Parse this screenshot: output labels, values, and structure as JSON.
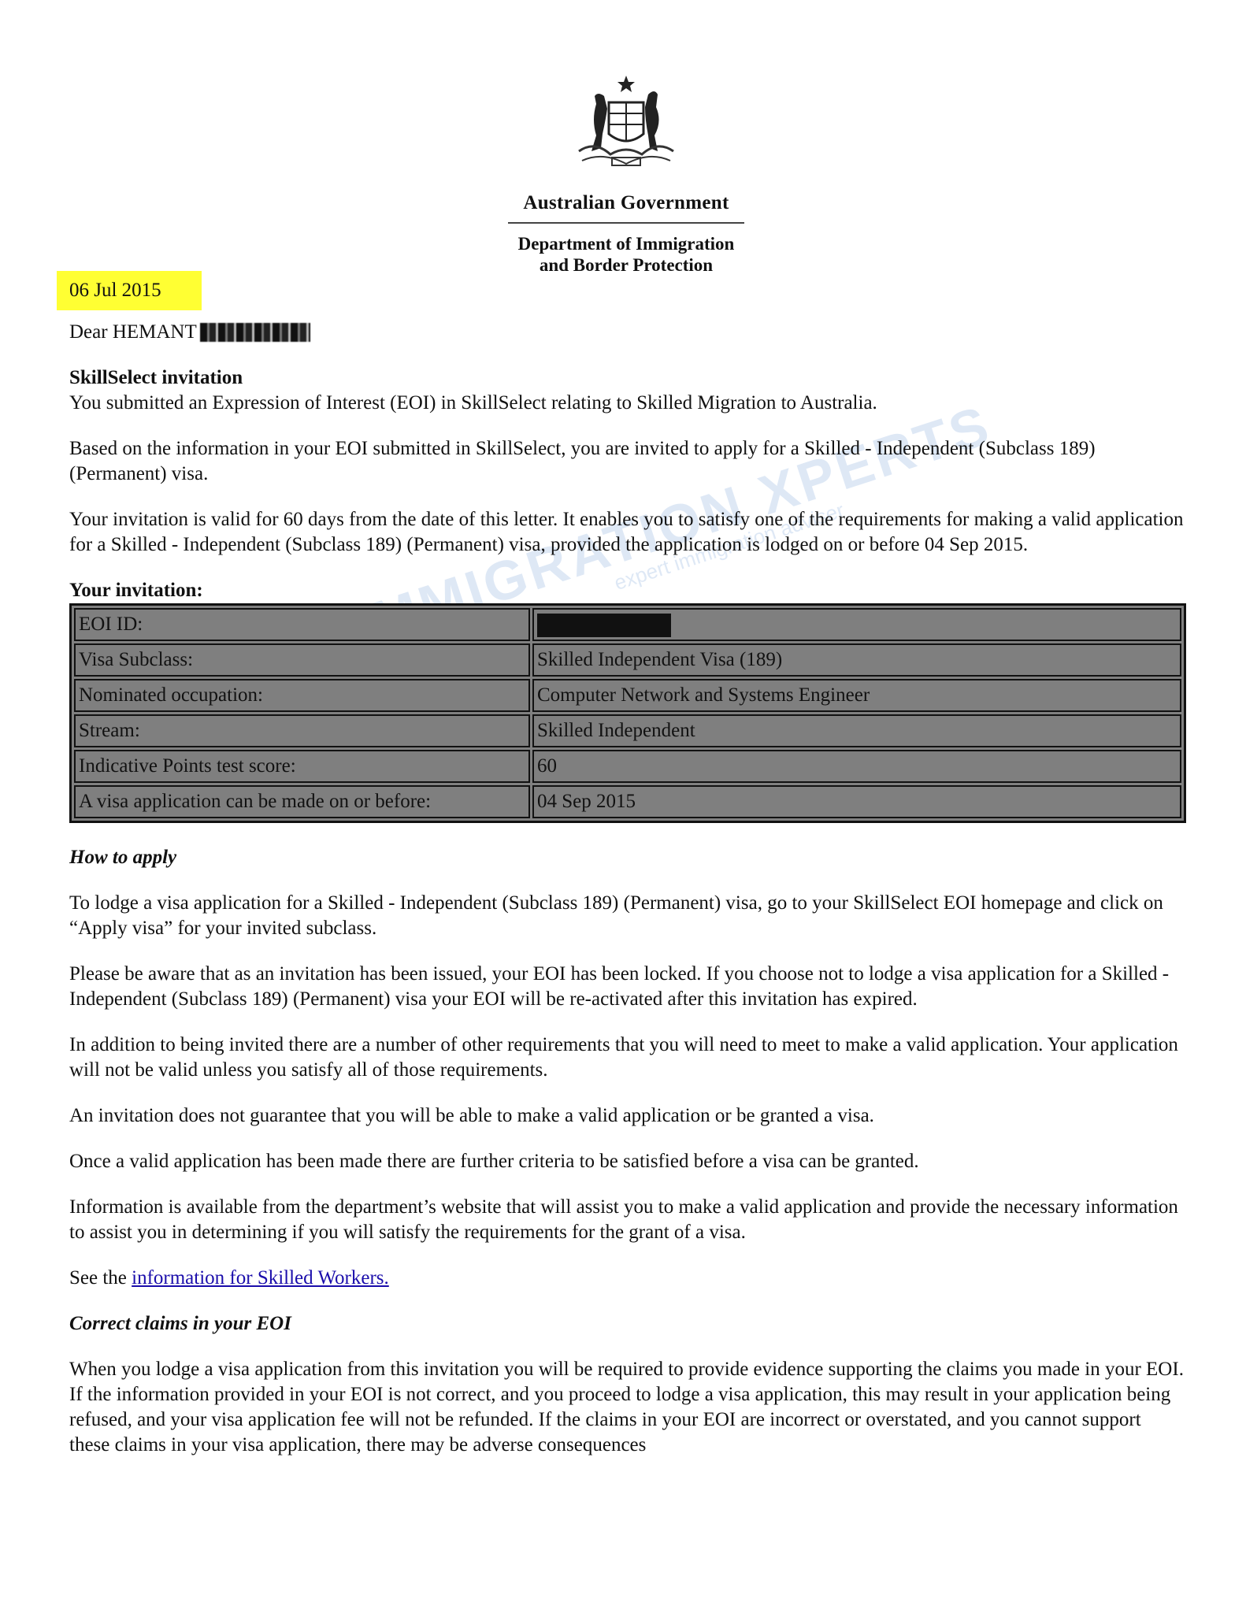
{
  "header": {
    "government": "Australian Government",
    "department_line1": "Department of Immigration",
    "department_line2": "and Border Protection",
    "crest_icon": "australian-coat-of-arms-icon"
  },
  "letter": {
    "date": "06 Jul 2015",
    "salutation": "Dear HEMANT",
    "subject": "SkillSelect invitation",
    "intro": "You submitted an Expression of Interest (EOI) in SkillSelect relating to Skilled Migration to Australia.",
    "invited": "Based on the information in your EOI submitted in SkillSelect, you are invited to apply for a Skilled - Independent (Subclass 189) (Permanent) visa.",
    "validity": "Your invitation is valid for 60 days from the date of this letter. It enables you to satisfy one of the requirements for making a valid application for a Skilled - Independent (Subclass 189) (Permanent) visa, provided the application is lodged on or before 04 Sep 2015.",
    "invitation_heading": "Your invitation:",
    "how_to_apply_heading": "How to apply",
    "how_to_apply": "To lodge a visa application for a Skilled - Independent (Subclass 189) (Permanent) visa, go to your SkillSelect EOI homepage and click on “Apply visa” for your invited subclass.",
    "locked": "Please be aware that as an invitation has been issued, your EOI has been locked. If you choose not to lodge a visa application for a Skilled - Independent (Subclass 189) (Permanent) visa your EOI will be re-activated after this invitation has expired.",
    "requirements": "In addition to being invited there are a number of other requirements that you will need to meet to make a valid application. Your application will not be valid unless you satisfy all of those requirements.",
    "no_guarantee": "An invitation does not guarantee that you will be able to make a valid application or be granted a visa.",
    "further_criteria": "Once a valid application has been made there are further criteria to be satisfied before a visa can be granted.",
    "information": "Information is available from the department’s website that will assist you to make a valid application and provide the necessary information to assist you in determining if you will satisfy the requirements for the grant of a visa.",
    "see_the": "See the ",
    "link_text": "information for Skilled Workers.",
    "correct_claims_heading": "Correct claims in your EOI",
    "correct_claims": "When you lodge a visa application from this invitation you will be required to provide evidence supporting the claims you made in your EOI. If the information provided in your EOI is not correct, and you proceed to lodge a visa application, this may result in your application being refused, and your visa application fee will not be refunded. If the claims in your EOI are incorrect or overstated, and you cannot support these claims in your visa application, there may be adverse consequences"
  },
  "invitation_table": [
    {
      "label": "EOI ID:",
      "value": ""
    },
    {
      "label": "Visa Subclass:",
      "value": "Skilled Independent Visa (189)"
    },
    {
      "label": "Nominated occupation:",
      "value": "Computer Network and Systems Engineer"
    },
    {
      "label": "Stream:",
      "value": "Skilled Independent"
    },
    {
      "label": "Indicative Points test score:",
      "value": "60"
    },
    {
      "label": "A visa application can be made on or before:",
      "value": "04 Sep 2015"
    }
  ],
  "watermark": {
    "main": "IMMIGRATION XPERTS",
    "sub": "expert immigration adviser"
  },
  "colors": {
    "highlight": "#ffff33",
    "table_fill": "#7f7f7f",
    "link": "#1a0dab",
    "watermark": "#6b9ad6"
  }
}
